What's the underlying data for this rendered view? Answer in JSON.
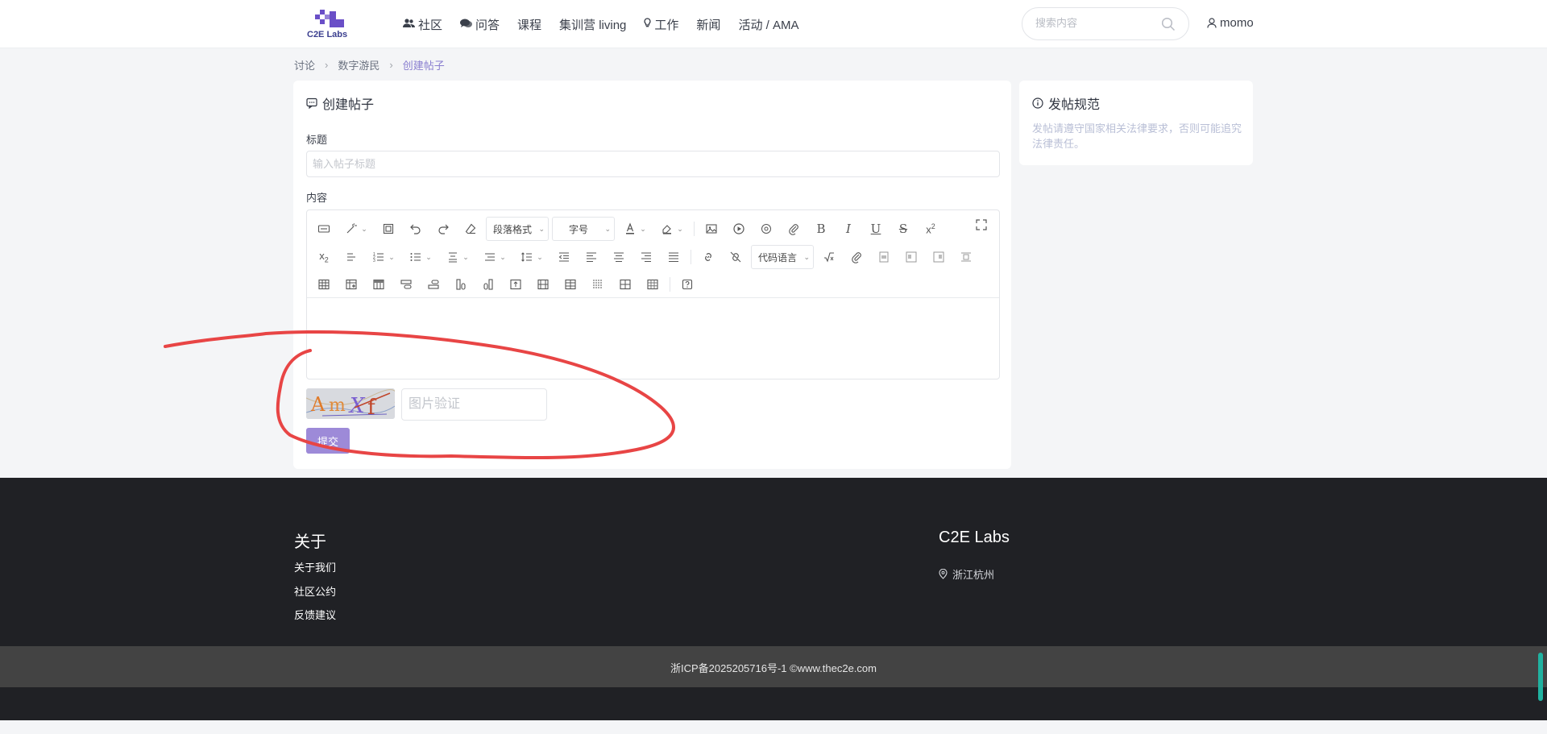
{
  "brand": {
    "logo_text": "C2E Labs",
    "accent": "#6a4fc7"
  },
  "nav": {
    "items": [
      {
        "label": "社区",
        "icon": "users-icon"
      },
      {
        "label": "问答",
        "icon": "chat-bubbles-icon"
      },
      {
        "label": "课程"
      },
      {
        "label": "集训营 living"
      },
      {
        "label": "工作",
        "icon": "lightbulb-icon"
      },
      {
        "label": "新闻"
      },
      {
        "label": "活动 / AMA"
      }
    ]
  },
  "search": {
    "placeholder": "搜索内容",
    "icon": "search-icon"
  },
  "user": {
    "name": "momo",
    "icon": "user-icon"
  },
  "breadcrumb": {
    "items": [
      "讨论",
      "数字游民",
      "创建帖子"
    ]
  },
  "form": {
    "heading": "创建帖子",
    "title_label": "标题",
    "title_placeholder": "输入帖子标题",
    "content_label": "内容",
    "toolbar": {
      "paragraph_format": "段落格式",
      "font_size": "字号",
      "code_language": "代码语言"
    },
    "captcha": {
      "image_text": "AmXf",
      "placeholder": "图片验证"
    },
    "submit_label": "提交",
    "submit_color": "#9d8ad8"
  },
  "rules": {
    "heading": "发帖规范",
    "text": "发帖请遵守国家相关法律要求，否则可能追究法律责任。"
  },
  "footer": {
    "about_heading": "关于",
    "links": [
      "关于我们",
      "社区公约",
      "反馈建议"
    ],
    "brand_heading": "C2E Labs",
    "location": "浙江杭州",
    "icp": "浙ICP备2025205716号-1 ©www.thec2e.com"
  },
  "annotation": {
    "color": "#e84545"
  }
}
